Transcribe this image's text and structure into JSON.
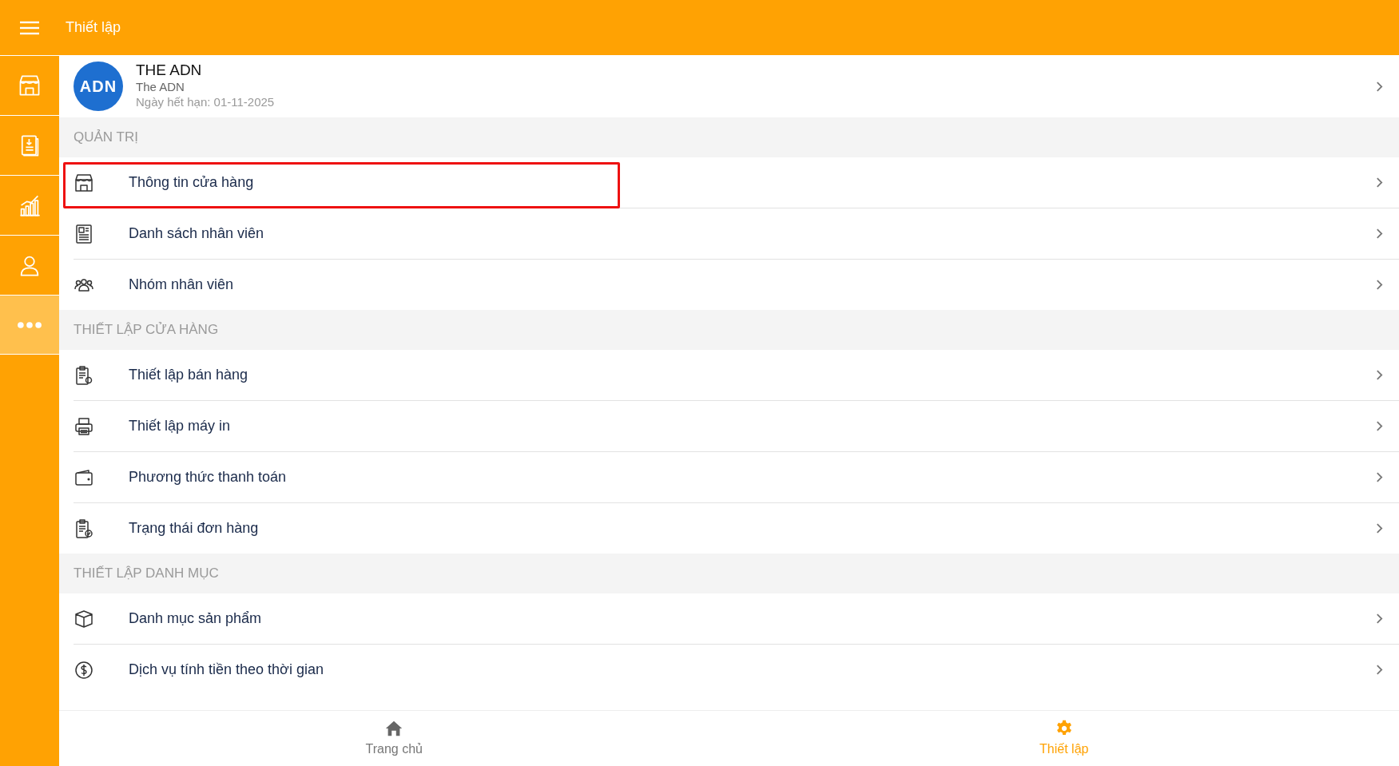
{
  "app_bar": {
    "title": "Thiết lập"
  },
  "side_nav": [
    {
      "kind": "store",
      "selected": false
    },
    {
      "kind": "invoice",
      "selected": false
    },
    {
      "kind": "chart",
      "selected": false
    },
    {
      "kind": "user",
      "selected": false
    },
    {
      "kind": "more",
      "selected": true
    }
  ],
  "account": {
    "logo_text": "ADN",
    "name": "THE ADN",
    "subtitle": "The ADN",
    "expiry": "Ngày hết hạn: 01-11-2025"
  },
  "sections": [
    {
      "title": "QUẢN TRỊ",
      "items": [
        {
          "kind": "store",
          "label": "Thông tin cửa hàng",
          "highlighted": true
        },
        {
          "kind": "staff-list",
          "label": "Danh sách nhân viên",
          "highlighted": false
        },
        {
          "kind": "group",
          "label": "Nhóm nhân viên",
          "highlighted": false
        }
      ]
    },
    {
      "title": "THIẾT LẬP CỬA HÀNG",
      "items": [
        {
          "kind": "sale-settings",
          "label": "Thiết lập bán hàng",
          "highlighted": false
        },
        {
          "kind": "printer",
          "label": "Thiết lập máy in",
          "highlighted": false
        },
        {
          "kind": "wallet",
          "label": "Phương thức thanh toán",
          "highlighted": false
        },
        {
          "kind": "order-status",
          "label": "Trạng thái đơn hàng",
          "highlighted": false
        }
      ]
    },
    {
      "title": "THIẾT LẬP DANH MỤC",
      "items": [
        {
          "kind": "box",
          "label": "Danh mục sản phẩm",
          "highlighted": false
        },
        {
          "kind": "coin",
          "label": "Dịch vụ tính tiền theo thời gian",
          "highlighted": false
        }
      ]
    }
  ],
  "bottom_nav": [
    {
      "kind": "home",
      "label": "Trang chủ",
      "selected": false
    },
    {
      "kind": "gear",
      "label": "Thiết lập",
      "selected": true
    }
  ]
}
